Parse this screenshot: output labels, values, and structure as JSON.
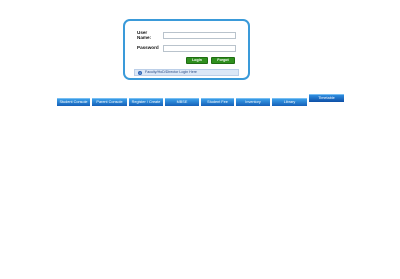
{
  "login": {
    "username_label": "User Name:",
    "password_label": "Password",
    "username_value": "",
    "password_value": "",
    "login_button": "Login",
    "forgot_button": "Forgot",
    "info_text": "Faculty/HoD/Director Login Here",
    "info_icon": "info-icon"
  },
  "tabs": [
    {
      "label": "Student Console"
    },
    {
      "label": "Parent Console"
    },
    {
      "label": "Register / Create"
    },
    {
      "label": "MBSE"
    },
    {
      "label": "Student Fee"
    },
    {
      "label": "Inventory"
    },
    {
      "label": "Library"
    },
    {
      "label": "Timetable"
    }
  ],
  "colors": {
    "box_border": "#3a9ad9",
    "button_green": "#2f8f1e",
    "tab_blue": "#1560b8"
  }
}
